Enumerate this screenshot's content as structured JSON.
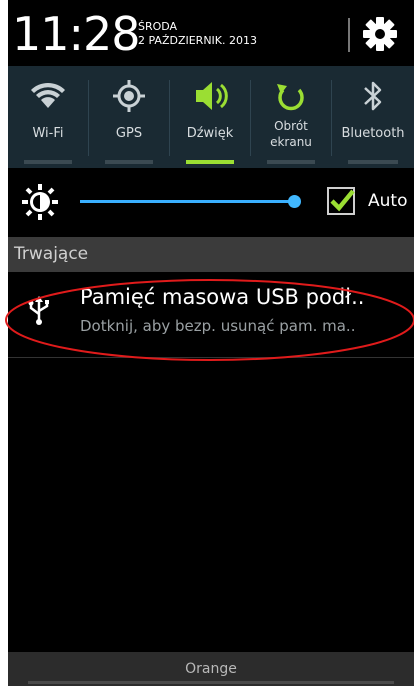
{
  "status": {
    "time": "11:28",
    "day": "ŚRODA",
    "date": "2 PAŹDZIERNIK. 2013"
  },
  "quick_settings": [
    {
      "label": "Wi-Fi",
      "icon": "wifi-icon",
      "active": false
    },
    {
      "label": "GPS",
      "icon": "gps-icon",
      "active": false
    },
    {
      "label": "Dźwięk",
      "icon": "sound-icon",
      "active": true
    },
    {
      "label": "Obrót ekranu",
      "icon": "rotate-icon",
      "active": false
    },
    {
      "label": "Bluetooth",
      "icon": "bluetooth-icon",
      "active": false
    }
  ],
  "brightness": {
    "level": 0.95,
    "auto_checked": true,
    "auto_label": "Auto"
  },
  "section_title": "Trwające",
  "notification": {
    "icon": "usb-icon",
    "title": "Pamięć masowa USB podł..",
    "subtitle": "Dotknij, aby bezp. usunąć pam. ma.."
  },
  "carrier": "Orange",
  "colors": {
    "accent_active": "#9BDE33",
    "brightness_track": "#3AB0FF",
    "quick_settings_bg": "#1A2A33",
    "highlight_oval": "#E01B1B"
  }
}
